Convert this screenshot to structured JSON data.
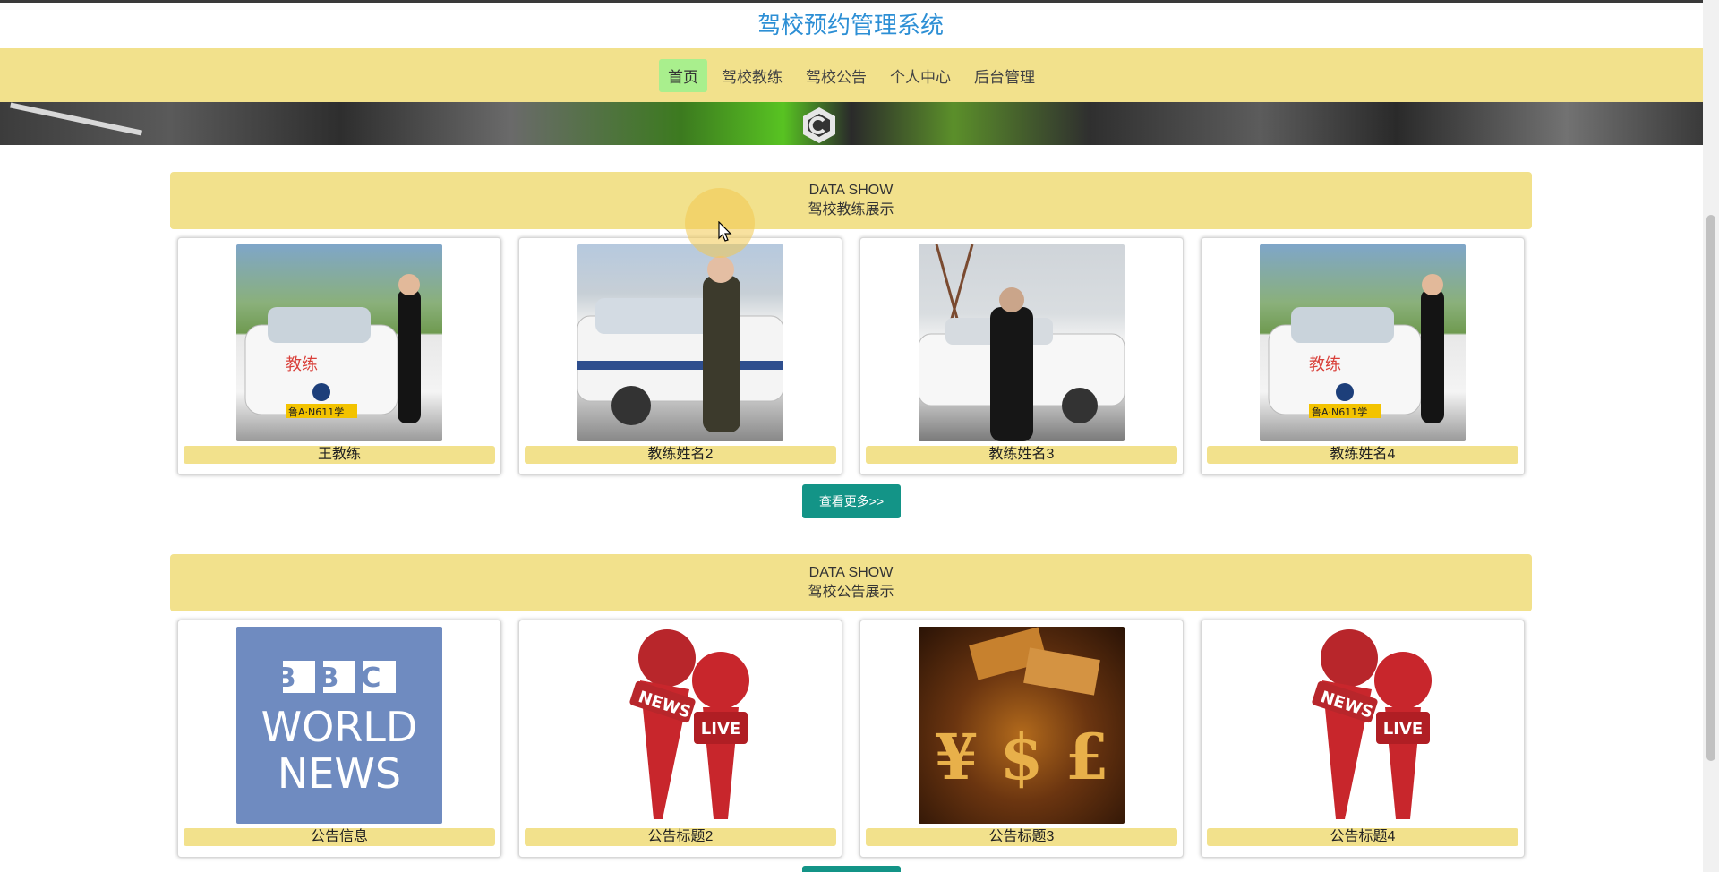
{
  "site": {
    "title": "驾校预约管理系统"
  },
  "nav": {
    "items": [
      {
        "label": "首页",
        "active": true
      },
      {
        "label": "驾校教练",
        "active": false
      },
      {
        "label": "驾校公告",
        "active": false
      },
      {
        "label": "个人中心",
        "active": false
      },
      {
        "label": "后台管理",
        "active": false
      }
    ]
  },
  "coach_section": {
    "title_en": "DATA SHOW",
    "title_cn": "驾校教练展示",
    "cards": [
      {
        "name": "王教练"
      },
      {
        "name": "教练姓名2"
      },
      {
        "name": "教练姓名3"
      },
      {
        "name": "教练姓名4"
      }
    ],
    "more_label": "查看更多>>"
  },
  "notice_section": {
    "title_en": "DATA SHOW",
    "title_cn": "驾校公告展示",
    "cards": [
      {
        "title": "公告信息"
      },
      {
        "title": "公告标题2"
      },
      {
        "title": "公告标题3"
      },
      {
        "title": "公告标题4"
      }
    ]
  },
  "images": {
    "bbc_line1": "BBC",
    "bbc_line2": "WORLD",
    "bbc_line3": "NEWS",
    "mic_news": "NEWS",
    "mic_live": "LIVE",
    "plate": "鲁A·N611学",
    "car_text": "教练",
    "money_symbols": "¥ $ £"
  },
  "colors": {
    "accent_title": "#2d8fd5",
    "nav_bg": "#f2e18c",
    "nav_active": "#a9ef8d",
    "button": "#139487"
  }
}
